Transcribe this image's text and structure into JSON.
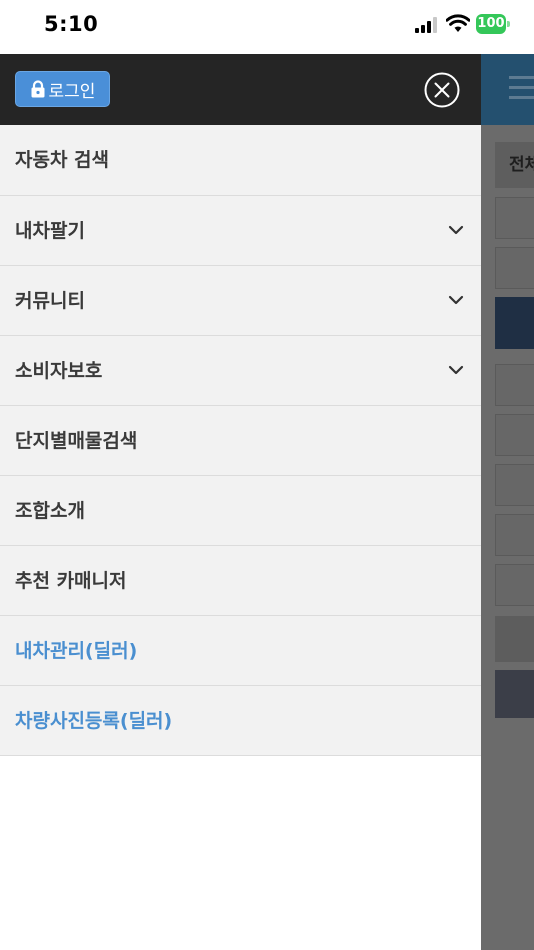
{
  "status_bar": {
    "time": "5:10",
    "battery": "100"
  },
  "drawer": {
    "login_label": "로그인",
    "menu": [
      {
        "label": "자동차 검색",
        "expandable": false,
        "dealer": false
      },
      {
        "label": "내차팔기",
        "expandable": true,
        "dealer": false
      },
      {
        "label": "커뮤니티",
        "expandable": true,
        "dealer": false
      },
      {
        "label": "소비자보호",
        "expandable": true,
        "dealer": false
      },
      {
        "label": "단지별매물검색",
        "expandable": false,
        "dealer": false
      },
      {
        "label": "조합소개",
        "expandable": false,
        "dealer": false
      },
      {
        "label": "추천 카매니저",
        "expandable": false,
        "dealer": false
      },
      {
        "label": "내차관리(딜러)",
        "expandable": false,
        "dealer": true
      },
      {
        "label": "차량사진등록(딜러)",
        "expandable": false,
        "dealer": true
      }
    ]
  },
  "background_page": {
    "tab_label": "전체"
  },
  "colors": {
    "drawer_header": "#252525",
    "login_button": "#4a8fd8",
    "menu_bg": "#f2f2f2",
    "dealer_text": "#4a8fd0",
    "battery": "#34c759"
  },
  "icons": {
    "lock": "lock-icon",
    "close": "close-icon",
    "chevron": "chevron-down-icon",
    "signal": "signal-icon",
    "wifi": "wifi-icon",
    "battery": "battery-icon"
  }
}
